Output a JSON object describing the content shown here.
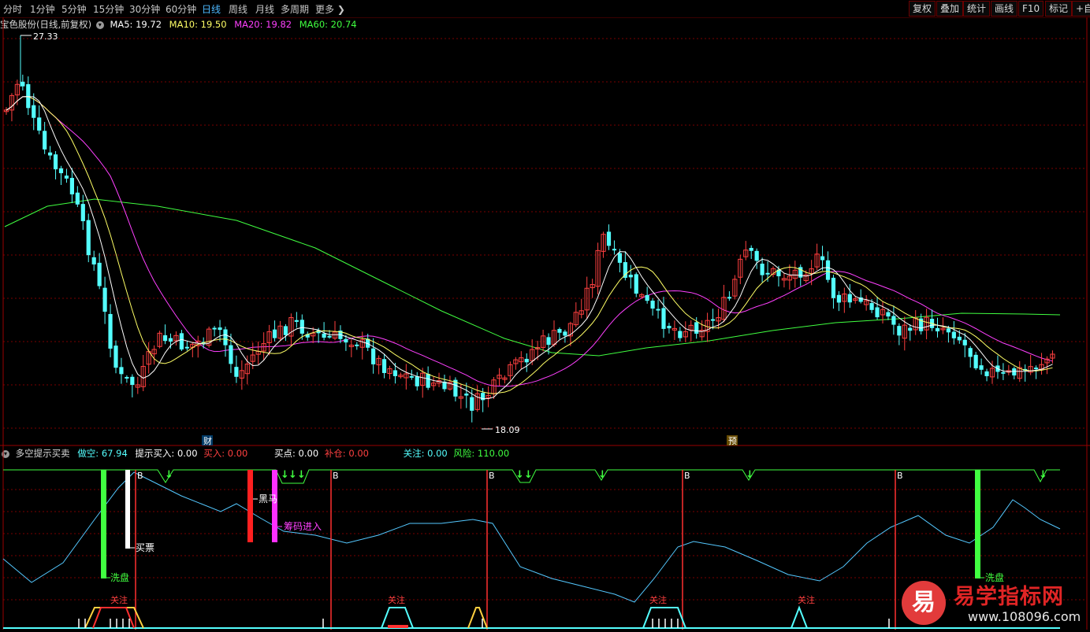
{
  "periods": [
    "分时",
    "1分钟",
    "5分钟",
    "15分钟",
    "30分钟",
    "60分钟",
    "日线",
    "周线",
    "月线",
    "多周期",
    "更多"
  ],
  "active_period": "日线",
  "toolbar": [
    "复权",
    "叠加",
    "统计",
    "画线",
    "F10",
    "标记",
    "+自"
  ],
  "main_info": {
    "title": "宝色股份(日线,前复权)",
    "ma5": "MA5: 19.72",
    "ma10": "MA10: 19.50",
    "ma20": "MA20: 19.82",
    "ma60": "MA60: 20.74"
  },
  "price_high": "27.33",
  "price_low": "18.09",
  "markers": {
    "cai": "财",
    "yu": "预"
  },
  "indicator": {
    "title": "多空提示买卖",
    "duokong": "做空: 67.94",
    "tishi": "提示买入: 0.00",
    "mairu": "买入: 0.00",
    "maidian": "买点: 0.00",
    "bucang": "补仓: 0.00",
    "guanzhu": "关注: 0.00",
    "fengxian": "风险: 110.00"
  },
  "signals": {
    "xipan": "洗盘",
    "maipiao": "买票",
    "heima": "黑马",
    "chouma": "筹码进入",
    "guanzhu": "关注",
    "b": "B"
  },
  "colors": {
    "up": "#ff4040",
    "down": "#54ffff",
    "ma5": "#ffffff",
    "ma10": "#ffff66",
    "ma20": "#ff40ff",
    "ma60": "#40ff40",
    "grid": "#7a0000"
  },
  "watermark": {
    "logo": "易",
    "name": "易学指标网",
    "url": "www.108096.com"
  }
}
